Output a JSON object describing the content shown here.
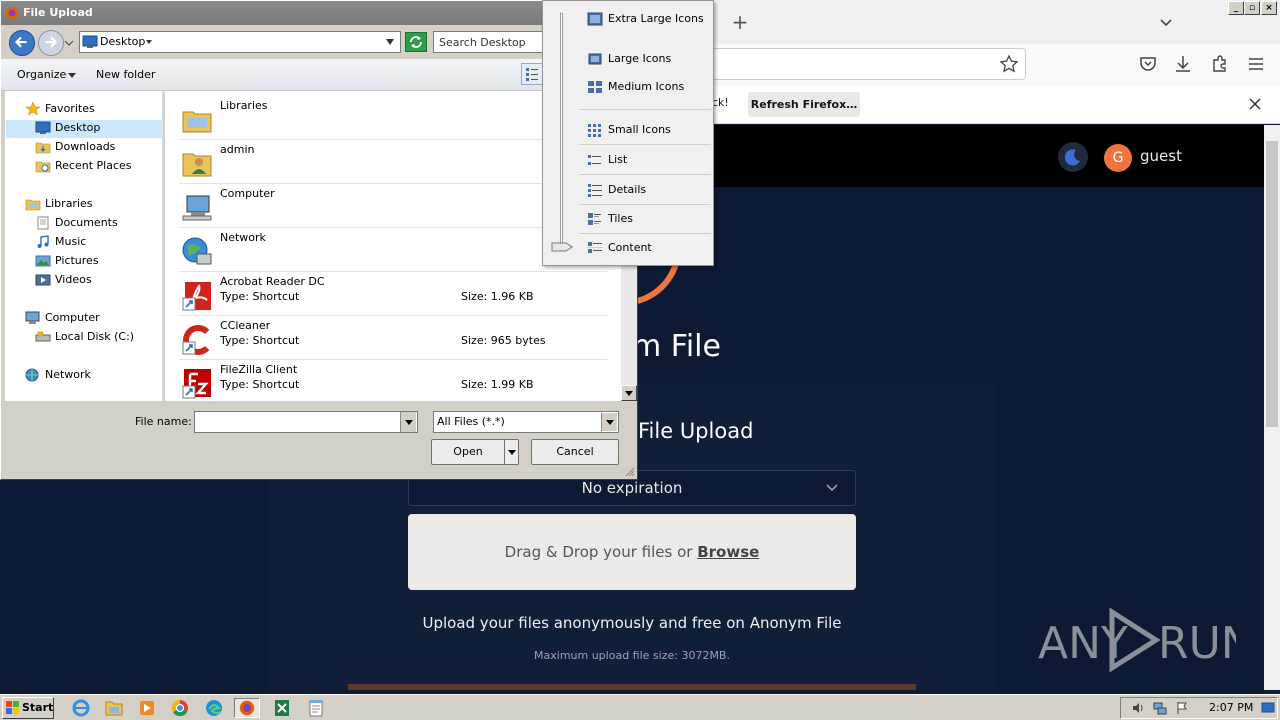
{
  "dialog": {
    "title": "File Upload",
    "address": "Desktop",
    "search_placeholder": "Search Desktop",
    "organize_label": "Organize",
    "new_folder_label": "New folder",
    "nav": {
      "favorites": "Favorites",
      "desktop": "Desktop",
      "downloads": "Downloads",
      "recent_places": "Recent Places",
      "libraries": "Libraries",
      "documents": "Documents",
      "music": "Music",
      "pictures": "Pictures",
      "videos": "Videos",
      "computer": "Computer",
      "local_disk": "Local Disk (C:)",
      "network": "Network"
    },
    "files": [
      {
        "name": "Libraries",
        "type": "",
        "size": "",
        "icon": "libraries-icon"
      },
      {
        "name": "admin",
        "type": "",
        "size": "",
        "icon": "user-folder-icon"
      },
      {
        "name": "Computer",
        "type": "",
        "size": "",
        "icon": "computer-icon"
      },
      {
        "name": "Network",
        "type": "",
        "size": "",
        "icon": "network-icon"
      },
      {
        "name": "Acrobat Reader DC",
        "type": "Type: Shortcut",
        "size": "Size: 1.96 KB",
        "icon": "acrobat-icon"
      },
      {
        "name": "CCleaner",
        "type": "Type: Shortcut",
        "size": "Size: 965 bytes",
        "icon": "ccleaner-icon"
      },
      {
        "name": "FileZilla Client",
        "type": "Type: Shortcut",
        "size": "Size: 1.99 KB",
        "icon": "filezilla-icon"
      }
    ],
    "file_name_label": "File name:",
    "file_name_value": "",
    "file_type_value": "All Files (*.*)",
    "open_label": "Open",
    "cancel_label": "Cancel"
  },
  "view_menu": {
    "items": [
      {
        "label": "Extra Large Icons",
        "icon": "extra-large-icons-icon"
      },
      {
        "label": "Large Icons",
        "icon": "large-icons-icon"
      },
      {
        "label": "Medium Icons",
        "icon": "medium-icons-icon"
      },
      {
        "label": "Small Icons",
        "icon": "small-icons-icon"
      },
      {
        "label": "List",
        "icon": "list-view-icon"
      },
      {
        "label": "Details",
        "icon": "details-view-icon"
      },
      {
        "label": "Tiles",
        "icon": "tiles-view-icon"
      },
      {
        "label": "Content",
        "icon": "content-view-icon"
      }
    ],
    "selected": "Content"
  },
  "firefox": {
    "new_tab_glyph": "+",
    "notification_text": "ck!",
    "refresh_button": "Refresh Firefox…"
  },
  "page": {
    "user_initial": "G",
    "user_name": "guest",
    "site_title": "m File",
    "section_title": "File Upload",
    "expiration": "No expiration",
    "drop_text": "Drag & Drop your files or ",
    "browse": "Browse",
    "description": "Upload your files anonymously and free on Anonym File",
    "max_size": "Maximum upload file size: 3072MB."
  },
  "watermark": {
    "left": "ANY",
    "right": "RUN"
  },
  "taskbar": {
    "start": "Start",
    "clock": "2:07 PM"
  },
  "colors": {
    "accent_orange": "#f0743e",
    "page_bg": "#0e1a33",
    "selection": "#cce8ff"
  }
}
